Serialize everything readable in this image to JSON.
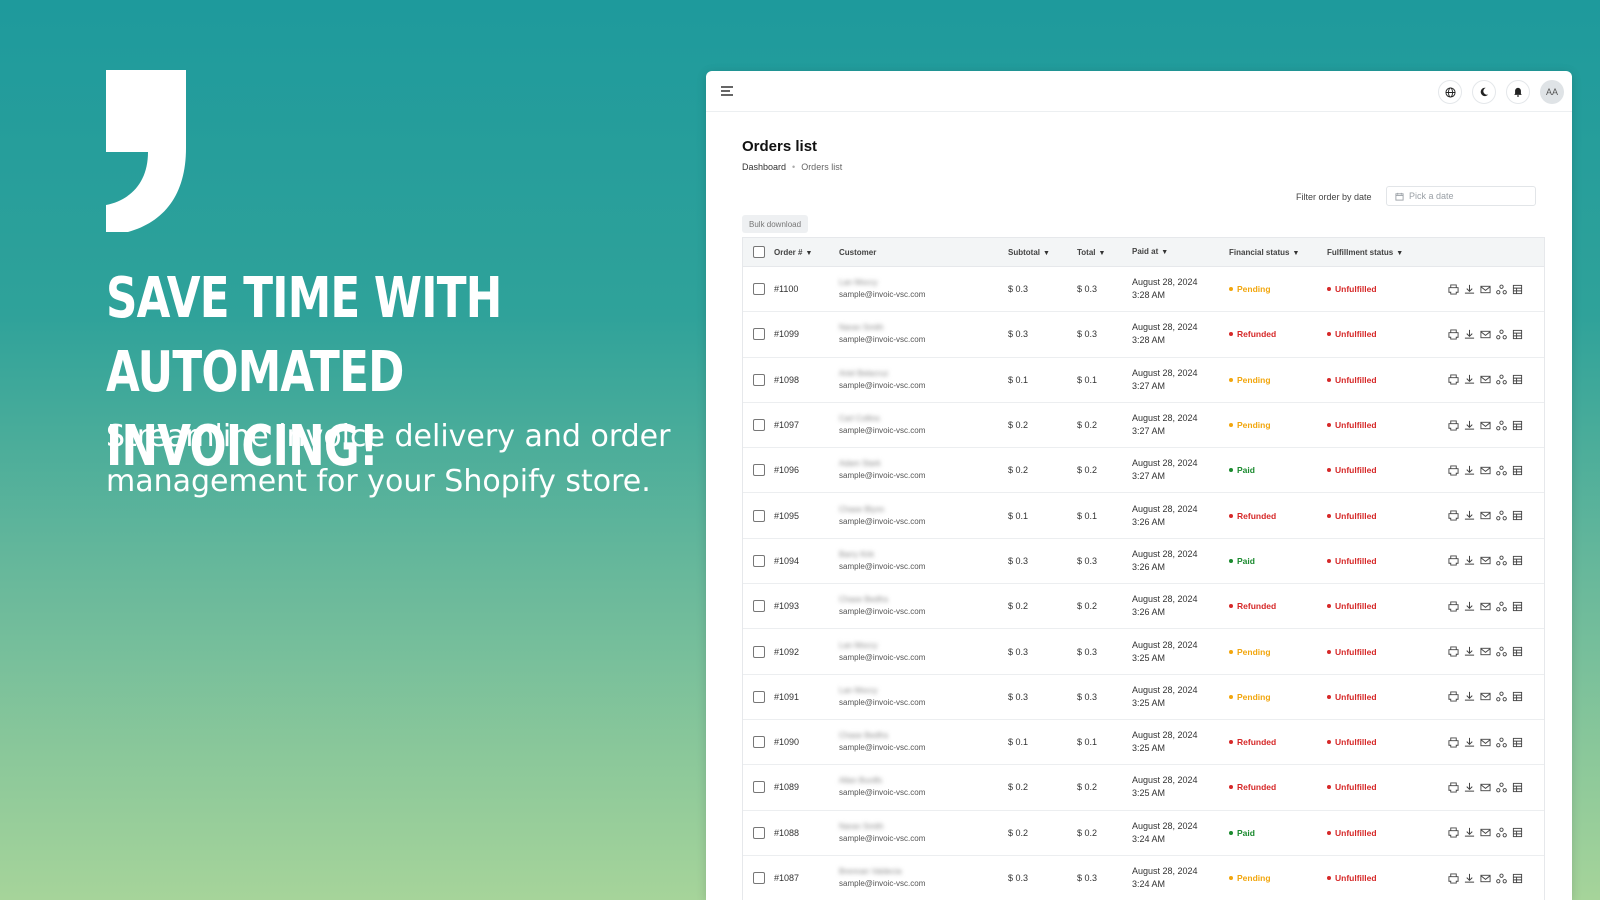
{
  "hero": {
    "headline": "SAVE TIME WITH AUTOMATED INVOICING!",
    "subline": "Streamline invoice delivery and order management for your Shopify store."
  },
  "app": {
    "avatar": "AA",
    "page_title": "Orders list",
    "breadcrumb": {
      "home": "Dashboard",
      "current": "Orders list"
    },
    "filter_label": "Filter order by date",
    "date_placeholder": "Pick a date",
    "bulk_download": "Bulk download",
    "columns": {
      "order": "Order #",
      "customer": "Customer",
      "subtotal": "Subtotal",
      "total": "Total",
      "paid_at": "Paid at",
      "financial": "Financial status",
      "fulfillment": "Fulfillment status"
    },
    "status_colors": {
      "Pending": "#f2a60d",
      "Refunded": "#d62828",
      "Paid": "#1a8a2e",
      "Unfulfilled": "#d62828"
    },
    "rows": [
      {
        "order": "#1100",
        "name": "Lan Moccy",
        "email": "sample@invoic-vsc.com",
        "subtotal": "$ 0.3",
        "total": "$ 0.3",
        "date": "August 28, 2024",
        "time": "3:28 AM",
        "financial": "Pending",
        "fulfillment": "Unfulfilled"
      },
      {
        "order": "#1099",
        "name": "Naran Smith",
        "email": "sample@invoic-vsc.com",
        "subtotal": "$ 0.3",
        "total": "$ 0.3",
        "date": "August 28, 2024",
        "time": "3:28 AM",
        "financial": "Refunded",
        "fulfillment": "Unfulfilled"
      },
      {
        "order": "#1098",
        "name": "Ariel Belacruz",
        "email": "sample@invoic-vsc.com",
        "subtotal": "$ 0.1",
        "total": "$ 0.1",
        "date": "August 28, 2024",
        "time": "3:27 AM",
        "financial": "Pending",
        "fulfillment": "Unfulfilled"
      },
      {
        "order": "#1097",
        "name": "Carl Collins",
        "email": "sample@invoic-vsc.com",
        "subtotal": "$ 0.2",
        "total": "$ 0.2",
        "date": "August 28, 2024",
        "time": "3:27 AM",
        "financial": "Pending",
        "fulfillment": "Unfulfilled"
      },
      {
        "order": "#1096",
        "name": "Adam Stark",
        "email": "sample@invoic-vsc.com",
        "subtotal": "$ 0.2",
        "total": "$ 0.2",
        "date": "August 28, 2024",
        "time": "3:27 AM",
        "financial": "Paid",
        "fulfillment": "Unfulfilled"
      },
      {
        "order": "#1095",
        "name": "Chase Blynn",
        "email": "sample@invoic-vsc.com",
        "subtotal": "$ 0.1",
        "total": "$ 0.1",
        "date": "August 28, 2024",
        "time": "3:26 AM",
        "financial": "Refunded",
        "fulfillment": "Unfulfilled"
      },
      {
        "order": "#1094",
        "name": "Barry Kirk",
        "email": "sample@invoic-vsc.com",
        "subtotal": "$ 0.3",
        "total": "$ 0.3",
        "date": "August 28, 2024",
        "time": "3:26 AM",
        "financial": "Paid",
        "fulfillment": "Unfulfilled"
      },
      {
        "order": "#1093",
        "name": "Chase Bedfra",
        "email": "sample@invoic-vsc.com",
        "subtotal": "$ 0.2",
        "total": "$ 0.2",
        "date": "August 28, 2024",
        "time": "3:26 AM",
        "financial": "Refunded",
        "fulfillment": "Unfulfilled"
      },
      {
        "order": "#1092",
        "name": "Lan Moccy",
        "email": "sample@invoic-vsc.com",
        "subtotal": "$ 0.3",
        "total": "$ 0.3",
        "date": "August 28, 2024",
        "time": "3:25 AM",
        "financial": "Pending",
        "fulfillment": "Unfulfilled"
      },
      {
        "order": "#1091",
        "name": "Lan Moccy",
        "email": "sample@invoic-vsc.com",
        "subtotal": "$ 0.3",
        "total": "$ 0.3",
        "date": "August 28, 2024",
        "time": "3:25 AM",
        "financial": "Pending",
        "fulfillment": "Unfulfilled"
      },
      {
        "order": "#1090",
        "name": "Chase Bedfra",
        "email": "sample@invoic-vsc.com",
        "subtotal": "$ 0.1",
        "total": "$ 0.1",
        "date": "August 28, 2024",
        "time": "3:25 AM",
        "financial": "Refunded",
        "fulfillment": "Unfulfilled"
      },
      {
        "order": "#1089",
        "name": "Allan Burdfs",
        "email": "sample@invoic-vsc.com",
        "subtotal": "$ 0.2",
        "total": "$ 0.2",
        "date": "August 28, 2024",
        "time": "3:25 AM",
        "financial": "Refunded",
        "fulfillment": "Unfulfilled"
      },
      {
        "order": "#1088",
        "name": "Naran Smith",
        "email": "sample@invoic-vsc.com",
        "subtotal": "$ 0.2",
        "total": "$ 0.2",
        "date": "August 28, 2024",
        "time": "3:24 AM",
        "financial": "Paid",
        "fulfillment": "Unfulfilled"
      },
      {
        "order": "#1087",
        "name": "Brennan Valdecia",
        "email": "sample@invoic-vsc.com",
        "subtotal": "$ 0.3",
        "total": "$ 0.3",
        "date": "August 28, 2024",
        "time": "3:24 AM",
        "financial": "Pending",
        "fulfillment": "Unfulfilled"
      }
    ],
    "row_actions": [
      "printer-icon",
      "download-icon",
      "mail-icon",
      "share-icon",
      "table-icon"
    ]
  }
}
